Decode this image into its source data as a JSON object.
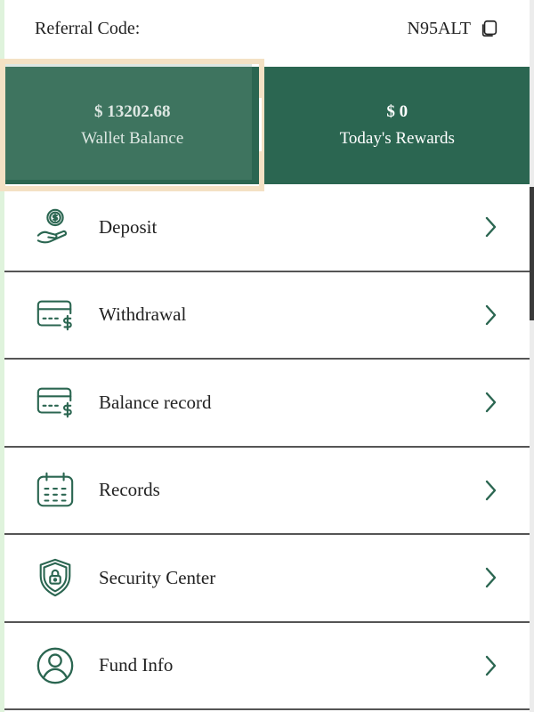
{
  "referral": {
    "label": "Referral Code:",
    "code": "N95ALT"
  },
  "balances": {
    "wallet_amount": "$ 13202.68",
    "wallet_label": "Wallet Balance",
    "rewards_amount": "$ 0",
    "rewards_label": "Today's Rewards"
  },
  "menu": [
    {
      "label": "Deposit",
      "icon": "coin-hand-icon"
    },
    {
      "label": "Withdrawal",
      "icon": "card-dollar-icon"
    },
    {
      "label": "Balance record",
      "icon": "card-dollar-icon"
    },
    {
      "label": "Records",
      "icon": "calendar-icon"
    },
    {
      "label": "Security Center",
      "icon": "shield-lock-icon"
    },
    {
      "label": "Fund Info",
      "icon": "user-circle-icon"
    }
  ],
  "colors": {
    "brand_green": "#2b6651",
    "icon_green": "#2b6651"
  }
}
